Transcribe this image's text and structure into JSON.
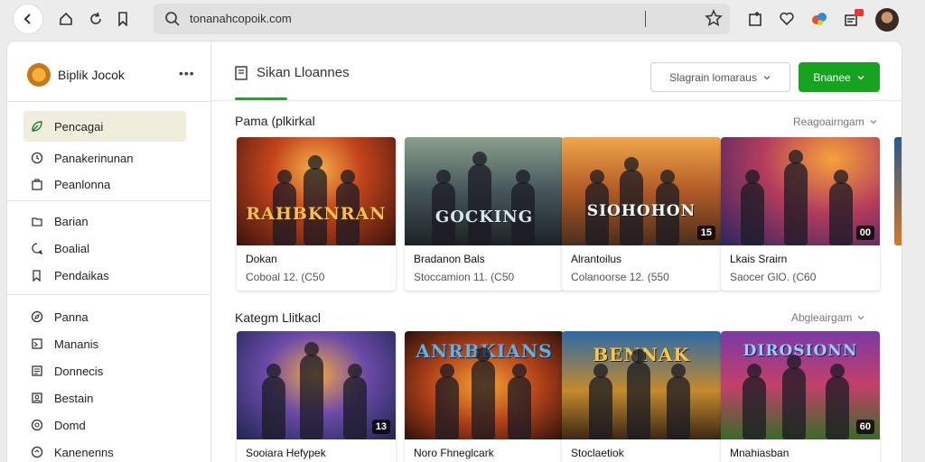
{
  "browser": {
    "url": "tonanahcopoik.com",
    "icons": [
      "back-arrow-icon",
      "home-icon",
      "refresh-icon",
      "bookmark-icon",
      "search-icon",
      "star-icon",
      "extension-icon",
      "heart-icon",
      "puzzle-icon",
      "notification-icon"
    ]
  },
  "sidebar": {
    "brand": "Biplik Jocok",
    "more": "•••",
    "groups": [
      [
        {
          "label": "Pencagai",
          "icon": "leaf-icon",
          "active": true
        },
        {
          "label": "Panakerinunan",
          "icon": "clock-icon"
        },
        {
          "label": "Peanlonna",
          "icon": "bag-icon"
        }
      ],
      [
        {
          "label": "Barian",
          "icon": "folder-icon"
        },
        {
          "label": "Boalial",
          "icon": "chat-icon"
        },
        {
          "label": "Pendaikas",
          "icon": "tag-icon"
        }
      ],
      [
        {
          "label": "Panna",
          "icon": "compass-icon"
        },
        {
          "label": "Mananis",
          "icon": "image-icon"
        },
        {
          "label": "Donnecis",
          "icon": "doc-icon"
        },
        {
          "label": "Bestain",
          "icon": "user-icon"
        },
        {
          "label": "Domd",
          "icon": "gear-icon"
        },
        {
          "label": "Kanenenns",
          "icon": "shield-icon"
        }
      ]
    ]
  },
  "topbar": {
    "tab_label": "Sikan Lloannes",
    "select_value": "Slagrain lomaraus",
    "cta_label": "Bnanee"
  },
  "sections": [
    {
      "title": "Pama (plkirkal",
      "link": "Reagoairngam",
      "cards": [
        {
          "art_word": "RAHBKNRAN",
          "name": "Dokan",
          "meta": "Coboal 12. (C50",
          "badge": ""
        },
        {
          "art_word": "GOCKING",
          "name": "Bradanon Bals",
          "meta": "Stoccamion 11. (C50",
          "badge": ""
        },
        {
          "art_word": "SIOHOHON",
          "name": "Alrantoilus",
          "meta": "Colanoorse 12. (550",
          "badge": "15"
        },
        {
          "art_word": "",
          "name": "Lkais Srairn",
          "meta": "Saocer GlO. (C60",
          "badge": "00"
        }
      ]
    },
    {
      "title": "Kategm Llitkacl",
      "link": "Abgleairgam",
      "cards": [
        {
          "art_word": "",
          "name": "Sooiara Hefypek",
          "meta": "",
          "badge": "13"
        },
        {
          "art_word": "ANRBKIANS",
          "name": "Noro Fhneglcark",
          "meta": "",
          "badge": ""
        },
        {
          "art_word": "BENNAK",
          "name": "Stoclaetiok",
          "meta": "",
          "badge": ""
        },
        {
          "art_word": "DIROSIONN",
          "name": "Mnahiasban",
          "meta": "",
          "badge": "60"
        }
      ]
    }
  ]
}
